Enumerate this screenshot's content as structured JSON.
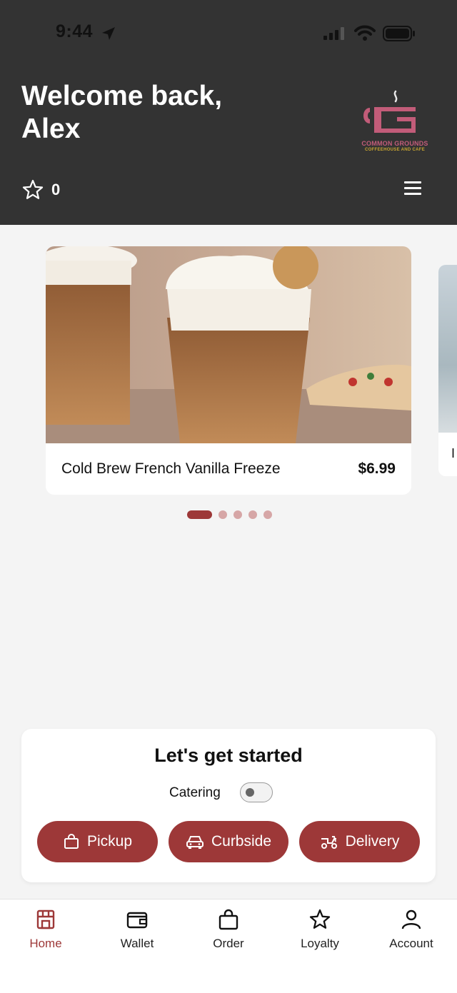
{
  "status_bar": {
    "time": "9:44"
  },
  "header": {
    "welcome": "Welcome back, Alex",
    "logo": {
      "name": "COMMON GROUNDS",
      "subtitle": "COFFEEHOUSE AND CAFE"
    },
    "points": "0",
    "icons": [
      "star-icon",
      "hamburger-menu-icon"
    ]
  },
  "carousel": {
    "cards": [
      {
        "title": "Cold Brew French Vanilla Freeze",
        "price": "$6.99"
      },
      {
        "title": "I"
      }
    ],
    "page_count": 5,
    "active_index": 0
  },
  "get_started": {
    "title": "Let's get started",
    "catering_label": "Catering",
    "catering_enabled": false,
    "buttons": {
      "pickup": "Pickup",
      "curbside": "Curbside",
      "delivery": "Delivery"
    }
  },
  "tabs": {
    "home": "Home",
    "wallet": "Wallet",
    "order": "Order",
    "loyalty": "Loyalty",
    "account": "Account",
    "active": "home"
  },
  "colors": {
    "header_bg": "#333333",
    "accent": "#9d3838",
    "page_bg": "#f4f4f4",
    "logo_pink": "#c25c79",
    "logo_gold": "#c9a532"
  }
}
